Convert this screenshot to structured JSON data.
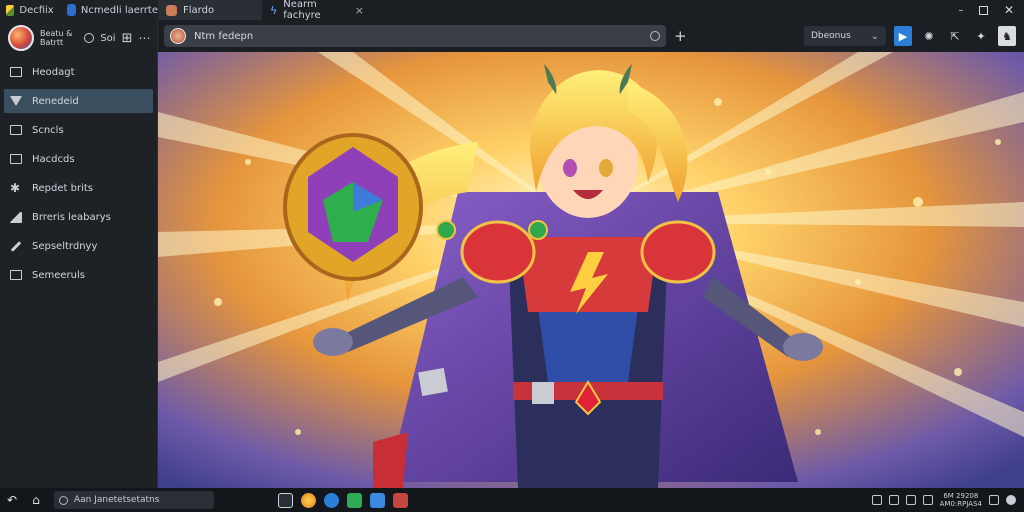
{
  "window": {
    "brand": "Decfiix",
    "brand_tab": "Ncmedli laerrte"
  },
  "tabs": [
    {
      "label": "Flardo",
      "active": true
    },
    {
      "label": "Nearm fachyre",
      "active": false
    }
  ],
  "window_controls": {
    "minimize": "–",
    "restore": "□",
    "close": "✕"
  },
  "profile": {
    "name_line1": "Beatu &",
    "name_line2": "Batrtt",
    "count": "Soi"
  },
  "sidebar": {
    "items": [
      {
        "label": "Heodagt",
        "icon": "monitor-icon",
        "selected": false
      },
      {
        "label": "Renedeid",
        "icon": "filter-icon",
        "selected": true
      },
      {
        "label": "Scncls",
        "icon": "folder-icon",
        "selected": false
      },
      {
        "label": "Hacdcds",
        "icon": "monitor-icon",
        "selected": false
      },
      {
        "label": "Repdet brits",
        "icon": "star-icon",
        "selected": false
      },
      {
        "label": "Brreris leabarys",
        "icon": "home-icon",
        "selected": false
      },
      {
        "label": "Sepseltrdnyy",
        "icon": "pen-icon",
        "selected": false
      },
      {
        "label": "Semeeruls",
        "icon": "list-icon",
        "selected": false
      }
    ]
  },
  "toolbar": {
    "address": "Ntm fedepn",
    "search_label": "Dbeonus",
    "search_caret": "⌄"
  },
  "taskbar": {
    "search_text": "Aan Janetetsetatns",
    "clock_line1": "6M 29208",
    "clock_line2": "AM0:RPJAS4"
  }
}
